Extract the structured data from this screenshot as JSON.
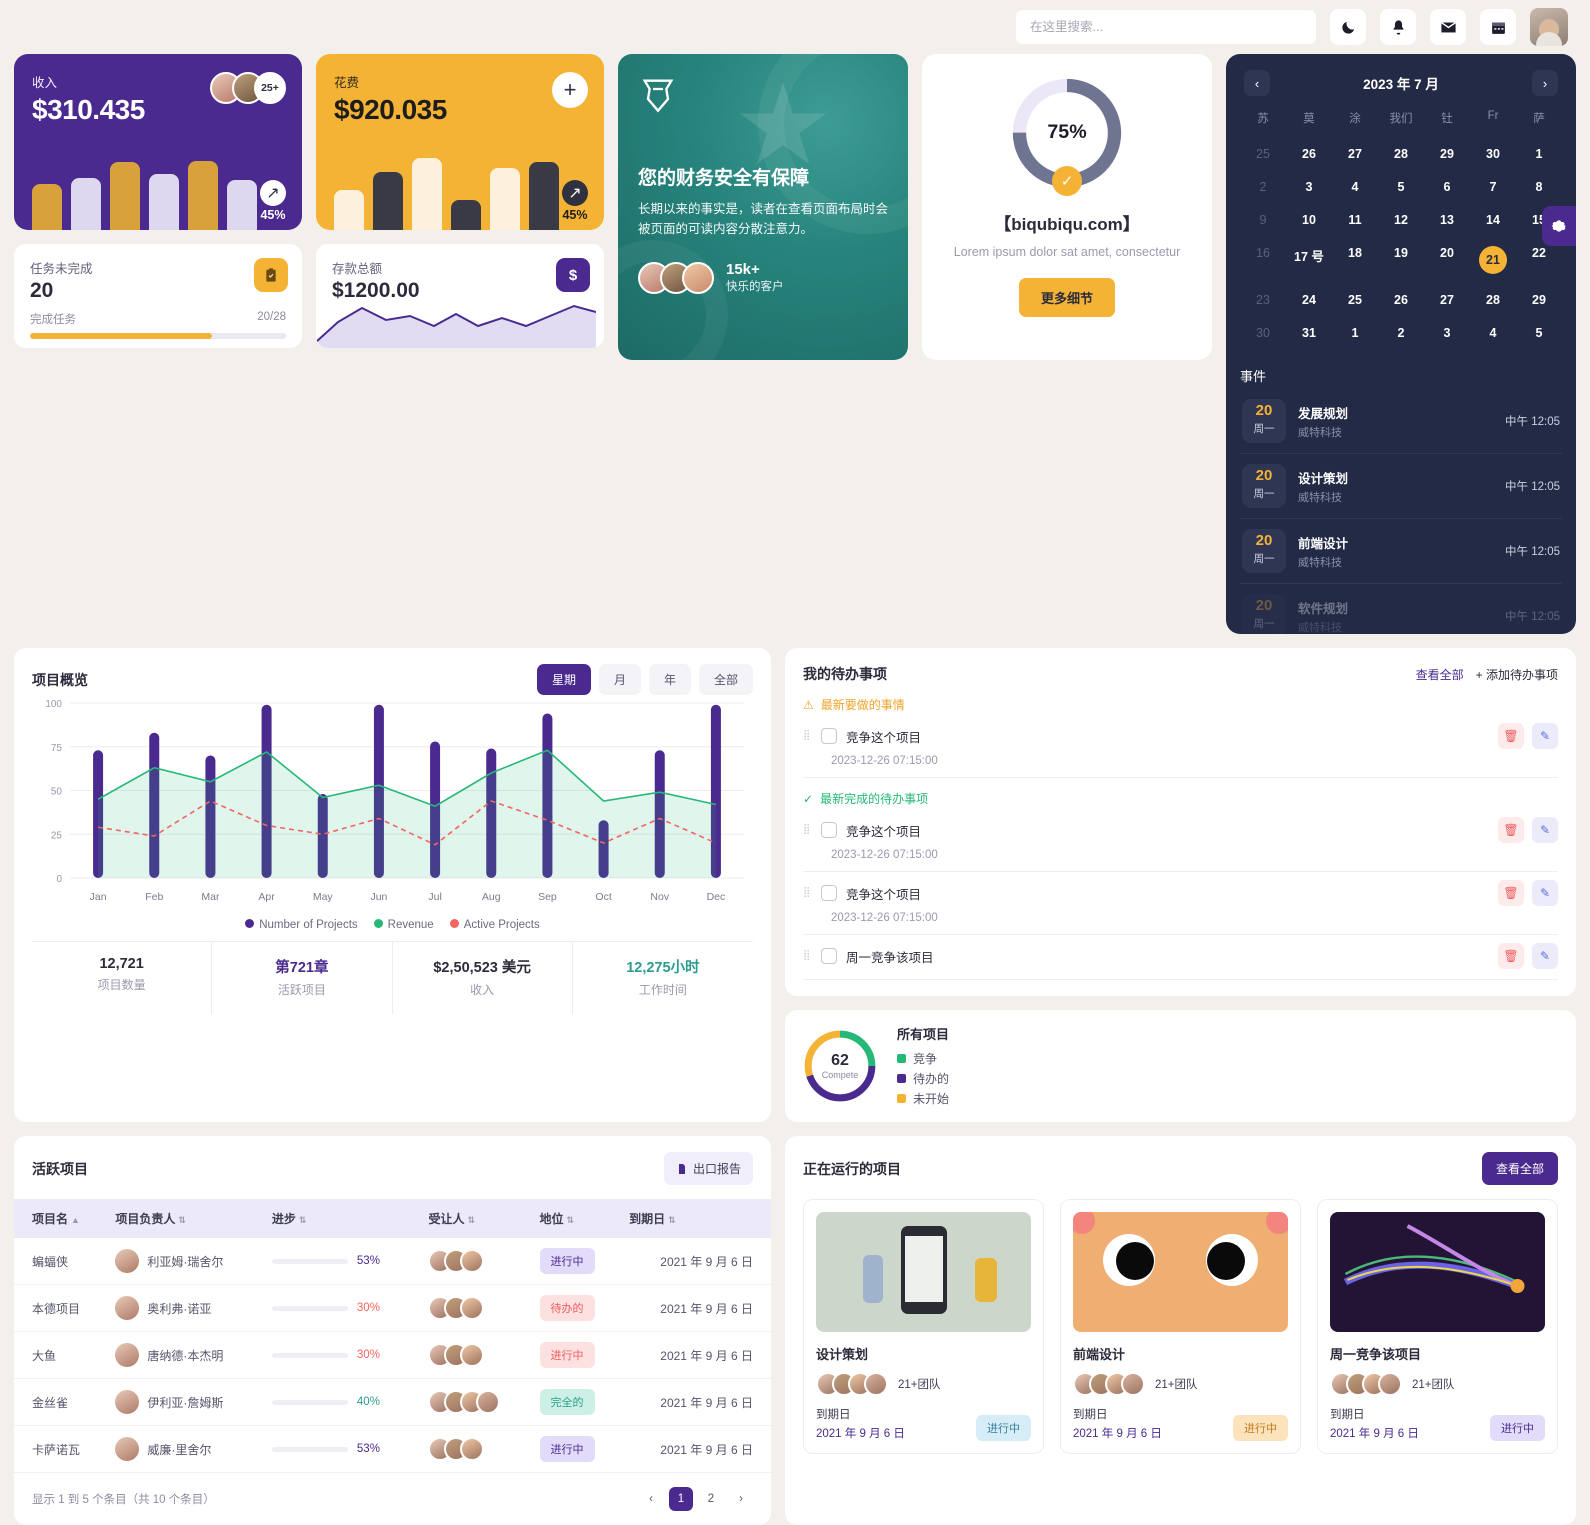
{
  "header": {
    "search_placeholder": "在这里搜索...",
    "search_value": "",
    "icons": [
      "moon-icon",
      "bell-icon",
      "mail-icon",
      "calendar-icon"
    ]
  },
  "income_card": {
    "label": "收入",
    "value": "$310.435",
    "pct": "45%",
    "more_avatars": "25+"
  },
  "expense_card": {
    "label": "花费",
    "value": "$920.035",
    "pct": "45%",
    "add_label": "+"
  },
  "tasks_card": {
    "label": "任务未完成",
    "value": "20",
    "sub_label": "完成任务",
    "ratio": "20/28",
    "progress": 71
  },
  "savings_card": {
    "label": "存款总额",
    "value": "$1200.00"
  },
  "promo": {
    "title": "您的财务安全有保障",
    "body": "长期以来的事实是，读者在查看页面布局时会被页面的可读内容分散注意力。",
    "count": "15k+",
    "caption": "快乐的客户"
  },
  "progress_card": {
    "percent": "75%",
    "title": "【biqubiqu.com】",
    "subtitle": "Lorem ipsum dolor sat amet, consectetur",
    "button": "更多细节"
  },
  "calendar": {
    "title": "2023 年 7 月",
    "prev": "‹",
    "next": "›",
    "dow": [
      "苏",
      "莫",
      "涂",
      "我们",
      "钍",
      "Fr",
      "萨"
    ],
    "weeks": [
      [
        {
          "d": "25",
          "mute": true
        },
        {
          "d": "26"
        },
        {
          "d": "27"
        },
        {
          "d": "28"
        },
        {
          "d": "29"
        },
        {
          "d": "30"
        },
        {
          "d": "1"
        }
      ],
      [
        {
          "d": "2",
          "mute": true
        },
        {
          "d": "3"
        },
        {
          "d": "4"
        },
        {
          "d": "5"
        },
        {
          "d": "6"
        },
        {
          "d": "7"
        },
        {
          "d": "8"
        }
      ],
      [
        {
          "d": "9",
          "mute": true
        },
        {
          "d": "10"
        },
        {
          "d": "11"
        },
        {
          "d": "12"
        },
        {
          "d": "13"
        },
        {
          "d": "14"
        },
        {
          "d": "15"
        }
      ],
      [
        {
          "d": "16",
          "mute": true
        },
        {
          "d": "17 号"
        },
        {
          "d": "18"
        },
        {
          "d": "19"
        },
        {
          "d": "20"
        },
        {
          "d": "21",
          "sel": true
        },
        {
          "d": "22"
        }
      ],
      [
        {
          "d": "23",
          "mute": true
        },
        {
          "d": "24"
        },
        {
          "d": "25"
        },
        {
          "d": "26"
        },
        {
          "d": "27"
        },
        {
          "d": "28"
        },
        {
          "d": "29"
        }
      ],
      [
        {
          "d": "30",
          "mute": true
        },
        {
          "d": "31"
        },
        {
          "d": "1"
        },
        {
          "d": "2"
        },
        {
          "d": "3"
        },
        {
          "d": "4"
        },
        {
          "d": "5"
        }
      ]
    ],
    "events_title": "事件",
    "events": [
      {
        "day": "20",
        "dow": "周一",
        "name": "发展规划",
        "org": "威特科技",
        "time": "中午 12:05"
      },
      {
        "day": "20",
        "dow": "周一",
        "name": "设计策划",
        "org": "威特科技",
        "time": "中午 12:05"
      },
      {
        "day": "20",
        "dow": "周一",
        "name": "前端设计",
        "org": "威特科技",
        "time": "中午 12:05"
      },
      {
        "day": "20",
        "dow": "周一",
        "name": "软件规划",
        "org": "威特科技",
        "time": "中午 12:05"
      }
    ]
  },
  "chart_panel": {
    "title": "项目概览",
    "tabs": [
      {
        "label": "星期",
        "active": true
      },
      {
        "label": "月",
        "active": false
      },
      {
        "label": "年",
        "active": false
      },
      {
        "label": "全部",
        "active": false
      }
    ],
    "stats": [
      {
        "n": "12,721",
        "c": "项目数量",
        "color": "#2b2b3b"
      },
      {
        "n": "第721章",
        "c": "活跃项目",
        "color": "#4a2a8f"
      },
      {
        "n": "$2,50,523 美元",
        "c": "收入",
        "color": "#2b2b3b"
      },
      {
        "n": "12,275小时",
        "c": "工作时间",
        "color": "#2a9d8f"
      }
    ]
  },
  "chart_data": {
    "type": "bar",
    "title": "项目概览",
    "xlabel": "",
    "ylabel": "",
    "ylim": [
      0,
      100
    ],
    "yticks": [
      0,
      25,
      50,
      75,
      100
    ],
    "grid": true,
    "legend_position": "bottom",
    "categories": [
      "Jan",
      "Feb",
      "Mar",
      "Apr",
      "May",
      "Jun",
      "Jul",
      "Aug",
      "Sep",
      "Oct",
      "Nov",
      "Dec"
    ],
    "series": [
      {
        "name": "Number of Projects",
        "type": "bar",
        "color": "#4a2a8f",
        "values": [
          73,
          83,
          70,
          99,
          48,
          99,
          78,
          74,
          94,
          33,
          73,
          99
        ]
      },
      {
        "name": "Revenue",
        "type": "area",
        "color": "#26b877",
        "values": [
          45,
          63,
          55,
          72,
          46,
          53,
          41,
          60,
          73,
          44,
          49,
          42
        ]
      },
      {
        "name": "Active Projects",
        "type": "line",
        "color": "#f4645f",
        "dashed": true,
        "values": [
          29,
          24,
          44,
          30,
          25,
          34,
          19,
          44,
          33,
          20,
          34,
          20
        ]
      }
    ]
  },
  "todo": {
    "title": "我的待办事项",
    "view_all": "查看全部",
    "add": "+ 添加待办事项",
    "section_pending": "最新要做的事情",
    "section_done": "最新完成的待办事项",
    "items": [
      {
        "text": "竞争这个项目",
        "time": "2023-12-26 07:15:00",
        "section": "pending"
      },
      {
        "text": "竞争这个项目",
        "time": "2023-12-26 07:15:00",
        "section": "done"
      },
      {
        "text": "竞争这个项目",
        "time": "2023-12-26 07:15:00",
        "section": ""
      },
      {
        "text": "周一竞争该项目",
        "time": "",
        "section": ""
      }
    ]
  },
  "all_projects": {
    "center_value": "62",
    "center_caption": "Compete",
    "title": "所有项目",
    "legend": [
      {
        "label": "竞争",
        "color": "#26b877",
        "value": 25
      },
      {
        "label": "待办的",
        "color": "#4a2a8f",
        "value": 45
      },
      {
        "label": "未开始",
        "color": "#f5b335",
        "value": 30
      }
    ]
  },
  "table": {
    "title": "活跃项目",
    "export": "出口报告",
    "columns": [
      "项目名",
      "项目负责人",
      "进步",
      "受让人",
      "地位",
      "到期日"
    ],
    "rows": [
      {
        "name": "蝙蝠侠",
        "manager": "利亚姆·瑞舍尔",
        "progress": "53%",
        "pv": 53,
        "pcolor": "#4a2a8f",
        "assignees": 3,
        "status": "进行中",
        "sbg": "#e2dcfa",
        "scolor": "#4a2a8f",
        "due": "2021 年 9 月 6 日"
      },
      {
        "name": "本德项目",
        "manager": "奥利弗·诺亚",
        "progress": "30%",
        "pv": 30,
        "pcolor": "#f4645f",
        "assignees": 3,
        "status": "待办的",
        "sbg": "#fde0e0",
        "scolor": "#ef5b5b",
        "due": "2021 年 9 月 6 日"
      },
      {
        "name": "大鱼",
        "manager": "唐纳德·本杰明",
        "progress": "30%",
        "pv": 30,
        "pcolor": "#f4645f",
        "assignees": 3,
        "status": "进行中",
        "sbg": "#fde0e0",
        "scolor": "#ef5b5b",
        "due": "2021 年 9 月 6 日"
      },
      {
        "name": "金丝雀",
        "manager": "伊利亚·詹姆斯",
        "progress": "40%",
        "pv": 40,
        "pcolor": "#2a9d8f",
        "assignees": 4,
        "status": "完全的",
        "sbg": "#cdf0e6",
        "scolor": "#2a9d8f",
        "due": "2021 年 9 月 6 日"
      },
      {
        "name": "卡萨诺瓦",
        "manager": "威廉·里舍尔",
        "progress": "53%",
        "pv": 53,
        "pcolor": "#4a2a8f",
        "assignees": 3,
        "status": "进行中",
        "sbg": "#e2dcfa",
        "scolor": "#4a2a8f",
        "due": "2021 年 9 月 6 日"
      }
    ],
    "footer": "显示 1 到 5 个条目（共 10 个条目）",
    "pages": [
      "1",
      "2"
    ],
    "prev": "‹",
    "next": "›"
  },
  "running": {
    "title": "正在运行的项目",
    "view_all": "查看全部",
    "due_label": "到期日",
    "projects": [
      {
        "name": "设计策划",
        "team": "21+团队",
        "due": "2021 年 9 月 6 日",
        "status": "进行中",
        "sbg": "#d6edf7",
        "scolor": "#3a7f9c",
        "thumb": "illustration-mobile"
      },
      {
        "name": "前端设计",
        "team": "21+团队",
        "due": "2021 年 9 月 6 日",
        "status": "进行中",
        "sbg": "#fde3bb",
        "scolor": "#c07a1c",
        "thumb": "illustration-face"
      },
      {
        "name": "周一竞争该项目",
        "team": "21+团队",
        "due": "2021 年 9 月 6 日",
        "status": "进行中",
        "sbg": "#e2dcfa",
        "scolor": "#4a2a8f",
        "thumb": "illustration-waves"
      }
    ]
  },
  "colors": {
    "accent_purple": "#4a2a8f",
    "accent_amber": "#f5b335",
    "accent_green": "#26b877",
    "accent_red": "#f4645f",
    "bg": "#f3f0ec"
  }
}
